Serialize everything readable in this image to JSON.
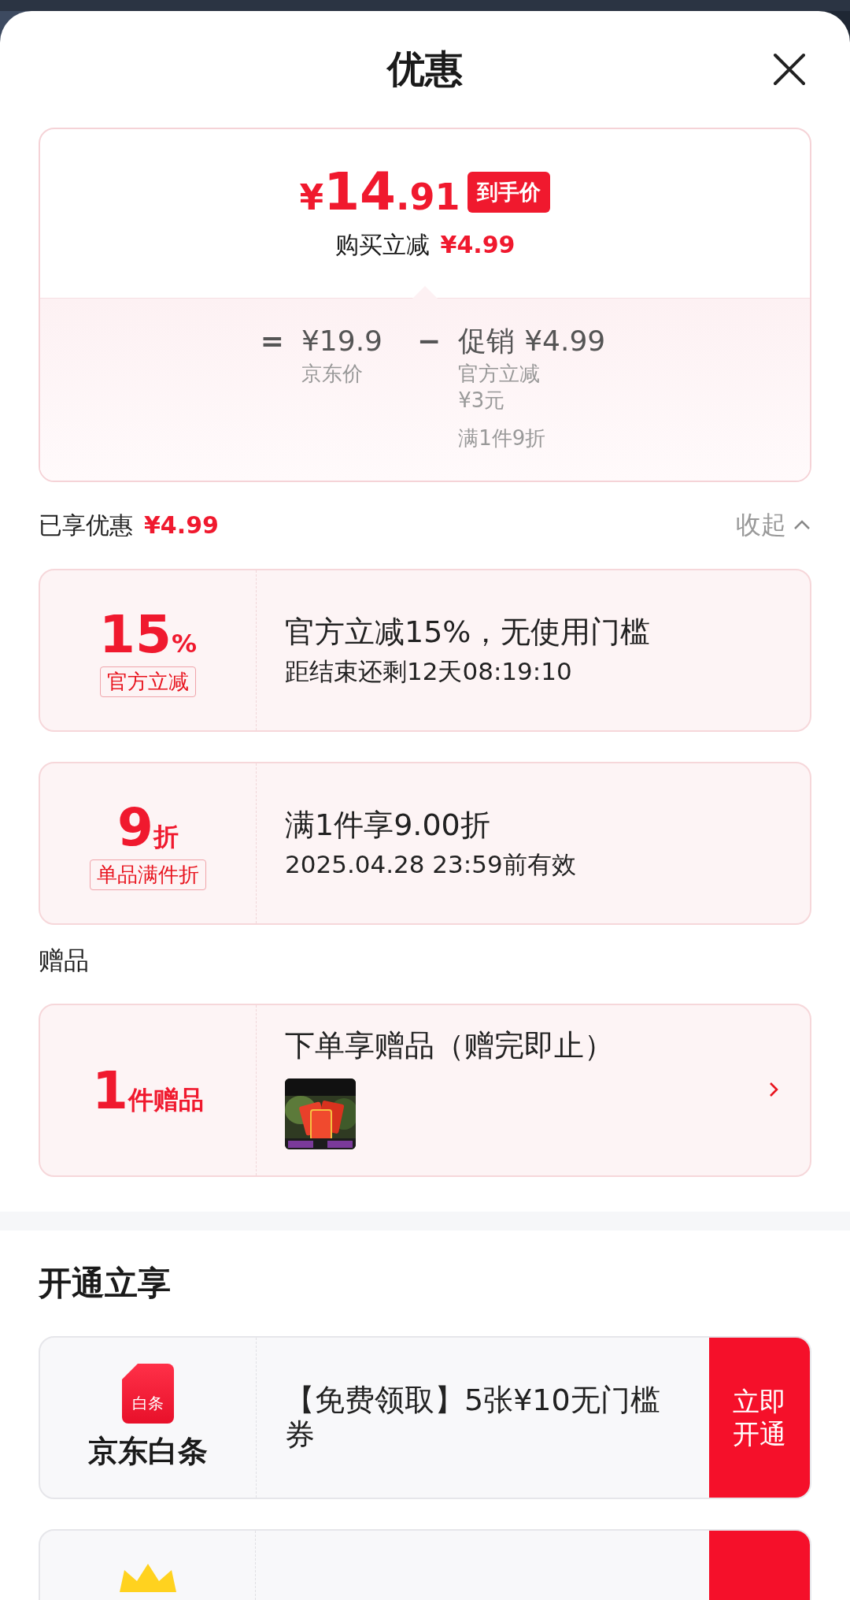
{
  "header": {
    "title": "优惠"
  },
  "price_summary": {
    "currency": "¥",
    "price_integer": "14",
    "price_decimal": ".91",
    "badge": "到手价",
    "discount_label": "购买立减",
    "discount_amount": "¥4.99",
    "breakdown": {
      "equals": "=",
      "jd_price": "¥19.9",
      "jd_price_label": "京东价",
      "minus": "−",
      "promo_label": "促销",
      "promo_amount": "¥4.99",
      "promo_details": [
        "官方立减",
        "¥3元",
        "满1件9折"
      ]
    }
  },
  "savings": {
    "label": "已享优惠",
    "amount": "¥4.99",
    "toggle": "收起",
    "expanded": true
  },
  "coupons": [
    {
      "value": "15",
      "unit": "%",
      "tag": "官方立减",
      "title": "官方立减15%，无使用门槛",
      "subtitle": "距结束还剩12天08:19:10"
    },
    {
      "value": "9",
      "unit": "折",
      "tag": "单品满件折",
      "title": "满1件享9.00折",
      "subtitle": "2025.04.28 23:59前有效"
    }
  ],
  "gifts": {
    "heading": "赠品",
    "count": "1",
    "unit": "件赠品",
    "title": "下单享赠品（赠完即止）"
  },
  "open_benefits": {
    "heading": "开通立享",
    "offers": [
      {
        "kind": "baitiao",
        "icon_label": "白条",
        "name": "京东白条",
        "description": "【免费领取】5张¥10无门槛券",
        "button": "立即开通"
      },
      {
        "kind": "crown"
      }
    ]
  }
}
